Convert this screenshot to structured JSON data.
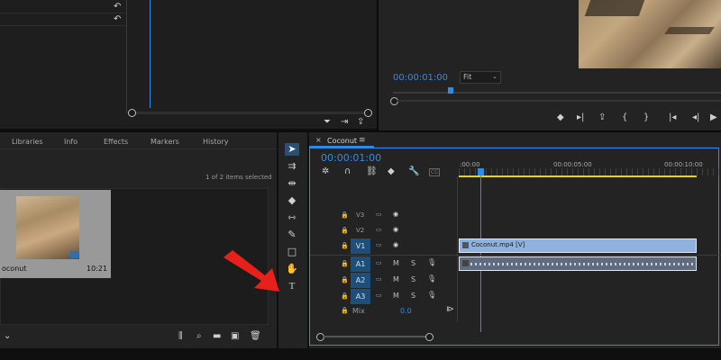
{
  "program_monitor": {
    "timecode": "00:00:01:00",
    "zoom_select": "Fit"
  },
  "project_panel": {
    "tabs": [
      "Libraries",
      "Info",
      "Effects",
      "Markers",
      "History"
    ],
    "selection_status": "1 of 2 items selected",
    "clip": {
      "name": "oconut",
      "duration": "10:21"
    }
  },
  "timeline": {
    "sequence_name": "Coconut",
    "menu_glyph": "≡",
    "close_glyph": "×",
    "timecode": "00:00:01:00",
    "ruler_labels": [
      ":00:00",
      "00:00:05:00",
      "00:00:10:00"
    ],
    "video_tracks": [
      "V3",
      "V2",
      "V1"
    ],
    "audio_tracks": [
      "A1",
      "A2",
      "A3"
    ],
    "mute_label": "M",
    "solo_label": "S",
    "mix_label": "Mix",
    "mix_value": "0.0",
    "video_clip_label": "Coconut.mp4 [V]",
    "cc_label": "CC"
  },
  "colors": {
    "accent_blue": "#2d8ceb",
    "clip_video": "#8fb1de",
    "clip_audio": "#5f6c7e",
    "work_area": "#e6d21c",
    "annotation_arrow": "#e8201c"
  },
  "icons": [
    "undo-icon",
    "filter-icon",
    "export-frame-icon",
    "selection-tool-icon",
    "track-select-icon",
    "ripple-edit-icon",
    "razor-icon",
    "slip-icon",
    "pen-icon",
    "rectangle-icon",
    "hand-icon",
    "type-tool-icon",
    "lock-icon",
    "eye-icon",
    "microphone-icon",
    "wrench-icon",
    "magnet-icon",
    "marker-icon"
  ]
}
